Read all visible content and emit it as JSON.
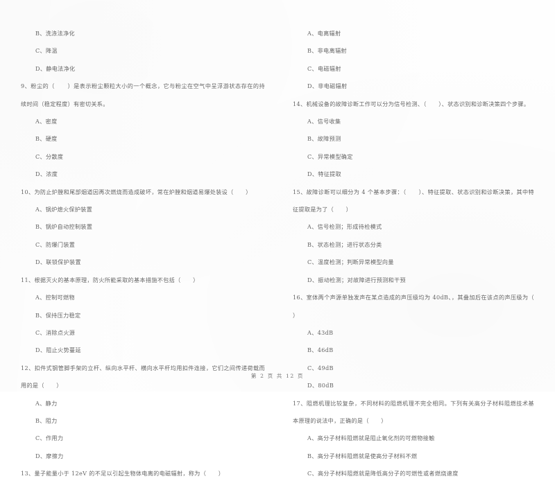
{
  "document": {
    "type": "exam-paper",
    "language": "zh-CN",
    "footer": "第 2 页 共 12 页",
    "page_number": 2,
    "total_pages": 12,
    "text_color": "#5a5a5a",
    "background_color": "#fefefe"
  },
  "columns": {
    "left": {
      "leading_options": [
        "B、洗涤法净化",
        "C、降温",
        "D、静电法净化"
      ],
      "questions": [
        {
          "number": "9",
          "stem": "9、粉尘的（      ）是表示粉尘颗粒大小的一个概念，它与粉尘在空气中呈浮游状态存在的持续时间（稳定程度）有密切关系。",
          "options": [
            "A、密度",
            "B、硬度",
            "C、分散度",
            "D、浓度"
          ]
        },
        {
          "number": "10",
          "stem": "10、为防止炉膛和尾部烟道因再次燃烧而造成破坏，常在炉膛和烟道易爆处装设（      ）",
          "options": [
            "A、锅炉熄火保护装置",
            "B、锅炉自动控制装置",
            "C、防爆门装置",
            "D、联锁保护装置"
          ]
        },
        {
          "number": "11",
          "stem": "11、根据灭火的基本原理，防火所能采取的基本措施不包括（      ）",
          "options": [
            "A、控制可燃物",
            "B、保持压力稳定",
            "C、消除点火源",
            "D、阻止火势蔓延"
          ]
        },
        {
          "number": "12",
          "stem": "12、扣件式钢管脚手架的立杆、纵向水平杆、横向水平杆均用扣件连接，它们之间传递荷载而用的是（      ）",
          "options": [
            "A、静力",
            "B、阻力",
            "C、作用力",
            "D、摩擦力"
          ]
        },
        {
          "number": "13",
          "stem": "13、量子能量小于 12eV 的不足以引起生物体电离的电磁辐射，称为（      ）",
          "options": []
        }
      ]
    },
    "right": {
      "leading_options": [
        "A、电离辐射",
        "B、非电离辐射",
        "C、电磁辐射",
        "D、非电磁辐射"
      ],
      "questions": [
        {
          "number": "14",
          "stem": "14、机械设备的故障诊断工作可以分为信号检测、（      ）、状态识别和诊断决策四个步骤。",
          "options": [
            "A、信号收集",
            "B、故障预测",
            "C、异常模型确定",
            "D、特征提取"
          ]
        },
        {
          "number": "15",
          "stem": "15、故障诊断可以细分为 4 个基本步骤：（      ）、特征提取、状态识别和诊断决策，其中特征提取是为了（      ）",
          "options": [
            "A、信号检测；形成待检模式",
            "B、状态检测；进行状态分类",
            "C、温度检测；判断异常模型向量",
            "D、振动检测；对故障进行预测和干预"
          ]
        },
        {
          "number": "16",
          "stem": "16、室体两个声源单独发声在某点造成的声压级均为 40dB、，其叠加后在该点的声压级为（      ）",
          "options": [
            "A、43dB",
            "B、46dB",
            "C、49dB",
            "D、80dB"
          ]
        },
        {
          "number": "17",
          "stem": "17、阻燃机理比较复杂，不同材料的阻燃机理不完全相同。下列有关高分子材料阻燃技术基本原理的说法中，正确的是（      ）",
          "options": [
            "A、高分子材料阻燃就是阻止氧化剂的可燃物接触",
            "B、高分子材料阻燃就是使高分子材料不燃",
            "C、高分子材料阻燃就是降低高分子的可燃性或者燃烧速度"
          ]
        }
      ]
    }
  }
}
